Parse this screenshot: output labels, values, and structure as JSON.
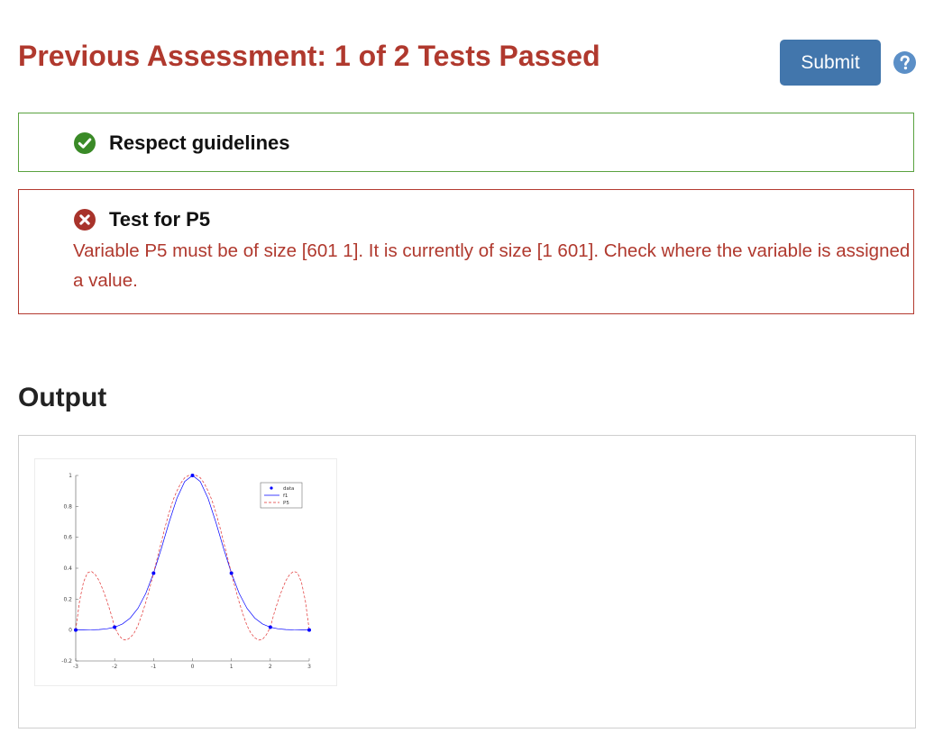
{
  "header": {
    "title": "Previous Assessment: 1 of 2 Tests Passed",
    "submit_label": "Submit",
    "help_icon": "question-circle-icon"
  },
  "tests": [
    {
      "name": "Respect guidelines",
      "status": "passed",
      "icon": "check-circle-icon",
      "color": "#3a8a27"
    },
    {
      "name": "Test for P5",
      "status": "failed",
      "icon": "x-circle-icon",
      "color": "#a8332b",
      "message": "Variable P5 must be of size [601 1]. It is currently of size [1 601]. Check where the variable is assigned a value."
    }
  ],
  "output": {
    "title": "Output"
  },
  "colors": {
    "title_red": "#b0392e",
    "submit_blue": "#4276ac",
    "help_blue": "#5b8fc7",
    "pass_border": "#5aa23f",
    "fail_border": "#b33a30"
  },
  "chart_data": {
    "type": "line",
    "xlim": [
      -3,
      3
    ],
    "ylim": [
      -0.2,
      1
    ],
    "x_ticks": [
      -3,
      -2,
      -1,
      0,
      1,
      2,
      3
    ],
    "y_ticks": [
      -0.2,
      0,
      0.2,
      0.4,
      0.6,
      0.8,
      1
    ],
    "x_tick_labels": [
      "-3",
      "-2",
      "-1",
      "0",
      "1",
      "2",
      "3"
    ],
    "y_tick_labels": [
      "-0.2",
      "0",
      "0.2",
      "0.4",
      "0.6",
      "0.8",
      "1"
    ],
    "legend_position": "top-right",
    "series": [
      {
        "name": "data",
        "style": "markers",
        "color": "#0000ff",
        "x": [
          -3,
          -2,
          -1,
          0,
          1,
          2,
          3
        ],
        "y": [
          0.0001,
          0.0183,
          0.3679,
          1.0,
          0.3679,
          0.0183,
          0.0001
        ]
      },
      {
        "name": "f1",
        "style": "solid",
        "color": "#0000ff",
        "x": [
          -3.0,
          -2.8,
          -2.6,
          -2.4,
          -2.2,
          -2.0,
          -1.8,
          -1.6,
          -1.4,
          -1.2,
          -1.0,
          -0.8,
          -0.6,
          -0.4,
          -0.2,
          0.0,
          0.2,
          0.4,
          0.6,
          0.8,
          1.0,
          1.2,
          1.4,
          1.6,
          1.8,
          2.0,
          2.2,
          2.4,
          2.6,
          2.8,
          3.0
        ],
        "y": [
          0.0001,
          0.0004,
          0.0012,
          0.0032,
          0.0079,
          0.0183,
          0.0392,
          0.0773,
          0.1409,
          0.2369,
          0.3679,
          0.5273,
          0.6977,
          0.8521,
          0.9608,
          1.0,
          0.9608,
          0.8521,
          0.6977,
          0.5273,
          0.3679,
          0.2369,
          0.1409,
          0.0773,
          0.0392,
          0.0183,
          0.0079,
          0.0032,
          0.0012,
          0.0004,
          0.0001
        ]
      },
      {
        "name": "P5",
        "style": "dashed",
        "color": "#e03030",
        "x": [
          -3.0,
          -2.9,
          -2.8,
          -2.7,
          -2.6,
          -2.5,
          -2.4,
          -2.3,
          -2.2,
          -2.1,
          -2.0,
          -1.9,
          -1.8,
          -1.7,
          -1.6,
          -1.5,
          -1.4,
          -1.3,
          -1.2,
          -1.1,
          -1.0,
          -0.9,
          -0.8,
          -0.7,
          -0.6,
          -0.5,
          -0.4,
          -0.3,
          -0.2,
          -0.1,
          0.0,
          0.1,
          0.2,
          0.3,
          0.4,
          0.5,
          0.6,
          0.7,
          0.8,
          0.9,
          1.0,
          1.1,
          1.2,
          1.3,
          1.4,
          1.5,
          1.6,
          1.7,
          1.8,
          1.9,
          2.0,
          2.1,
          2.2,
          2.3,
          2.4,
          2.5,
          2.6,
          2.7,
          2.8,
          2.9,
          3.0
        ],
        "y": [
          0.0001,
          0.19,
          0.31,
          0.37,
          0.38,
          0.36,
          0.32,
          0.26,
          0.19,
          0.11,
          0.0183,
          -0.03,
          -0.06,
          -0.065,
          -0.05,
          -0.02,
          0.03,
          0.1,
          0.18,
          0.27,
          0.3679,
          0.47,
          0.57,
          0.67,
          0.76,
          0.84,
          0.9,
          0.95,
          0.985,
          1.0,
          1.0,
          1.0,
          0.985,
          0.95,
          0.9,
          0.84,
          0.76,
          0.67,
          0.57,
          0.47,
          0.3679,
          0.27,
          0.18,
          0.1,
          0.03,
          -0.02,
          -0.05,
          -0.065,
          -0.06,
          -0.03,
          0.0183,
          0.11,
          0.19,
          0.26,
          0.32,
          0.36,
          0.38,
          0.37,
          0.31,
          0.19,
          0.0001
        ]
      }
    ]
  }
}
